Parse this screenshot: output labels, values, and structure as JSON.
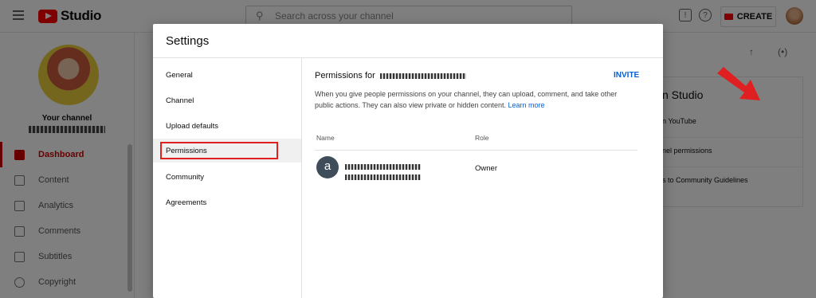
{
  "header": {
    "logo_text": "Studio",
    "search_placeholder": "Search across your channel",
    "create_label": "CREATE"
  },
  "sidebar": {
    "channel_title": "Your channel",
    "items": [
      {
        "label": "Dashboard",
        "icon": "dashboard-icon",
        "active": true
      },
      {
        "label": "Content",
        "icon": "content-icon"
      },
      {
        "label": "Analytics",
        "icon": "analytics-icon"
      },
      {
        "label": "Comments",
        "icon": "comments-icon"
      },
      {
        "label": "Subtitles",
        "icon": "subtitles-icon"
      },
      {
        "label": "Copyright",
        "icon": "copyright-icon"
      }
    ]
  },
  "background_card": {
    "title": "n Studio",
    "lines": [
      "n YouTube",
      "nel permissions",
      "s to Community Guidelines"
    ]
  },
  "dialog": {
    "title": "Settings",
    "menu": [
      "General",
      "Channel",
      "Upload defaults",
      "Permissions",
      "Community",
      "Agreements"
    ],
    "selected_menu": "Permissions",
    "permissions_title": "Permissions for",
    "invite_label": "INVITE",
    "description": "When you give people permissions on your channel, they can upload, comment, and take other public actions. They can also view private or hidden content.",
    "learn_more": "Learn more",
    "columns": {
      "name": "Name",
      "role": "Role"
    },
    "users": [
      {
        "avatar_letter": "a",
        "role": "Owner"
      }
    ]
  },
  "colors": {
    "accent": "#cc0000",
    "link": "#065fd4",
    "annotation": "#e02020"
  }
}
